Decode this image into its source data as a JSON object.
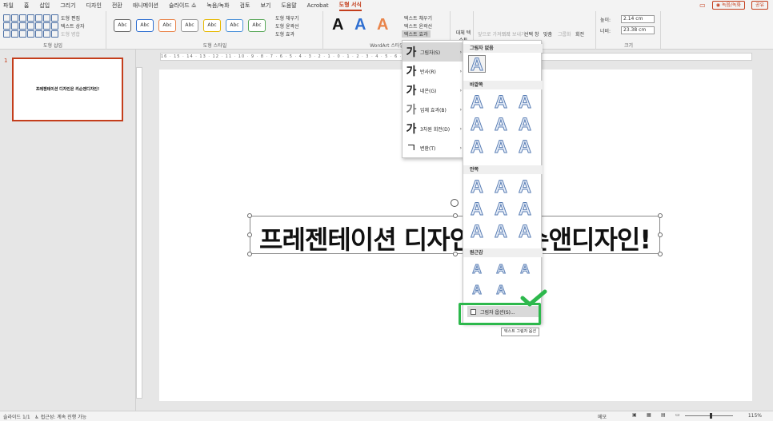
{
  "menubar": {
    "tabs": [
      "파일",
      "홈",
      "삽입",
      "그리기",
      "디자인",
      "전환",
      "애니메이션",
      "슬라이드 쇼",
      "녹음/녹화",
      "검토",
      "보기",
      "도움말",
      "Acrobat",
      "도형 서식"
    ],
    "active_tab": "도형 서식",
    "record_label": "◉ 녹음/녹화",
    "share_label": "공유"
  },
  "ribbon": {
    "insert_shapes": {
      "edit_shape": "도형 편집",
      "text_box": "텍스트 상자",
      "merge": "도형 병합",
      "label": "도형 삽입"
    },
    "shape_styles": {
      "abc_label": "Abc",
      "fill": "도형 채우기",
      "outline": "도형 윤곽선",
      "effects": "도형 효과",
      "label": "도형 스타일"
    },
    "wordart": {
      "letter": "A",
      "text_fill": "텍스트 채우기",
      "text_outline": "텍스트 윤곽선",
      "text_effects": "텍스트 효과",
      "label": "WordArt 스타일"
    },
    "alt_text": "대체 텍스트",
    "arrange": {
      "bring_forward": "앞으로 가져오기",
      "send_backward": "뒤로 보내기",
      "selection_pane": "선택 창",
      "align": "맞춤",
      "group": "그룹화",
      "rotate": "회전"
    },
    "size": {
      "height_label": "높이:",
      "height_value": "2.14 cm",
      "width_label": "너비:",
      "width_value": "23.38 cm",
      "label": "크기"
    }
  },
  "thumbnail": {
    "number": "1",
    "text": "프레젠테이션 디자인은 리슨앤디자인!"
  },
  "ruler_text": "16 · 15 · 14 · 13 · 12 · 11 · 10 · 9 · 8 · 7 · 6 · 5 · 4 · 3 · 2 · 1 · 0 · 1 · 2 · 3 · 4 · 5 · 6 · 7 · 8 · 9 · 10 · 11 · 12 · 13 · 14 · 15 · 16",
  "slide": {
    "title": "프레젠테이션 디자인은 리슨앤디자인!"
  },
  "effects_menu": {
    "glyph": "가",
    "items": [
      "그림자(S)",
      "반사(R)",
      "네온(G)",
      "입체 효과(B)",
      "3차원 회전(D)",
      "변환(T)"
    ],
    "active_index": 0
  },
  "shadow_menu": {
    "no_shadow": "그림자 없음",
    "outer": "바깥쪽",
    "inner": "안쪽",
    "perspective": "원근감",
    "swatch_letter": "A",
    "options": "그림자 옵션(S)...",
    "tooltip": "텍스트 그림자 옵션"
  },
  "statusbar": {
    "slide_info": "슬라이드 1/1",
    "accessibility": "접근성: 계속 진행 가능",
    "notes": "메모",
    "zoom": "115%"
  },
  "colors": {
    "accent": "#c43e1c",
    "highlight": "#2db84c",
    "wordart_blue": "#2f6fd1",
    "wordart_orange": "#e9844a"
  }
}
